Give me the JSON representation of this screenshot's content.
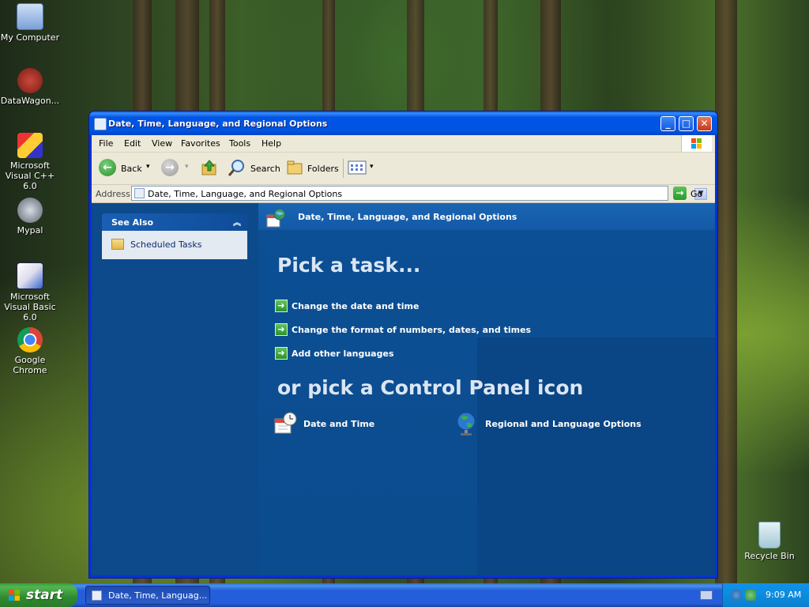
{
  "desktop": {
    "icons": [
      {
        "label": "My Computer"
      },
      {
        "label": "DataWagon..."
      },
      {
        "label": "Microsoft Visual C++ 6.0"
      },
      {
        "label": "Mypal"
      },
      {
        "label": "Microsoft Visual Basic 6.0"
      },
      {
        "label": "Google Chrome"
      },
      {
        "label": "Recycle Bin"
      }
    ]
  },
  "window": {
    "title": "Date, Time, Language, and Regional Options",
    "menu": [
      "File",
      "Edit",
      "View",
      "Favorites",
      "Tools",
      "Help"
    ],
    "toolbar": {
      "back": "Back",
      "search": "Search",
      "folders": "Folders"
    },
    "address": {
      "label": "Address",
      "value": "Date, Time, Language, and Regional Options",
      "go": "Go"
    },
    "see_also": {
      "header": "See Also",
      "items": [
        "Scheduled Tasks"
      ]
    },
    "content": {
      "header": "Date, Time, Language, and Regional Options",
      "pick_task": "Pick a task...",
      "tasks": [
        "Change the date and time",
        "Change the format of numbers, dates, and times",
        "Add other languages"
      ],
      "or_pick": "or pick a Control Panel icon",
      "icons": [
        "Date and Time",
        "Regional and Language Options"
      ]
    }
  },
  "taskbar": {
    "start": "start",
    "task_button": "Date, Time, Languag...",
    "clock": "9:09 AM"
  },
  "colors": {
    "titlebar": "#0054e3",
    "content_bg": "#0e4e91",
    "task_arrow": "#2b922b"
  }
}
